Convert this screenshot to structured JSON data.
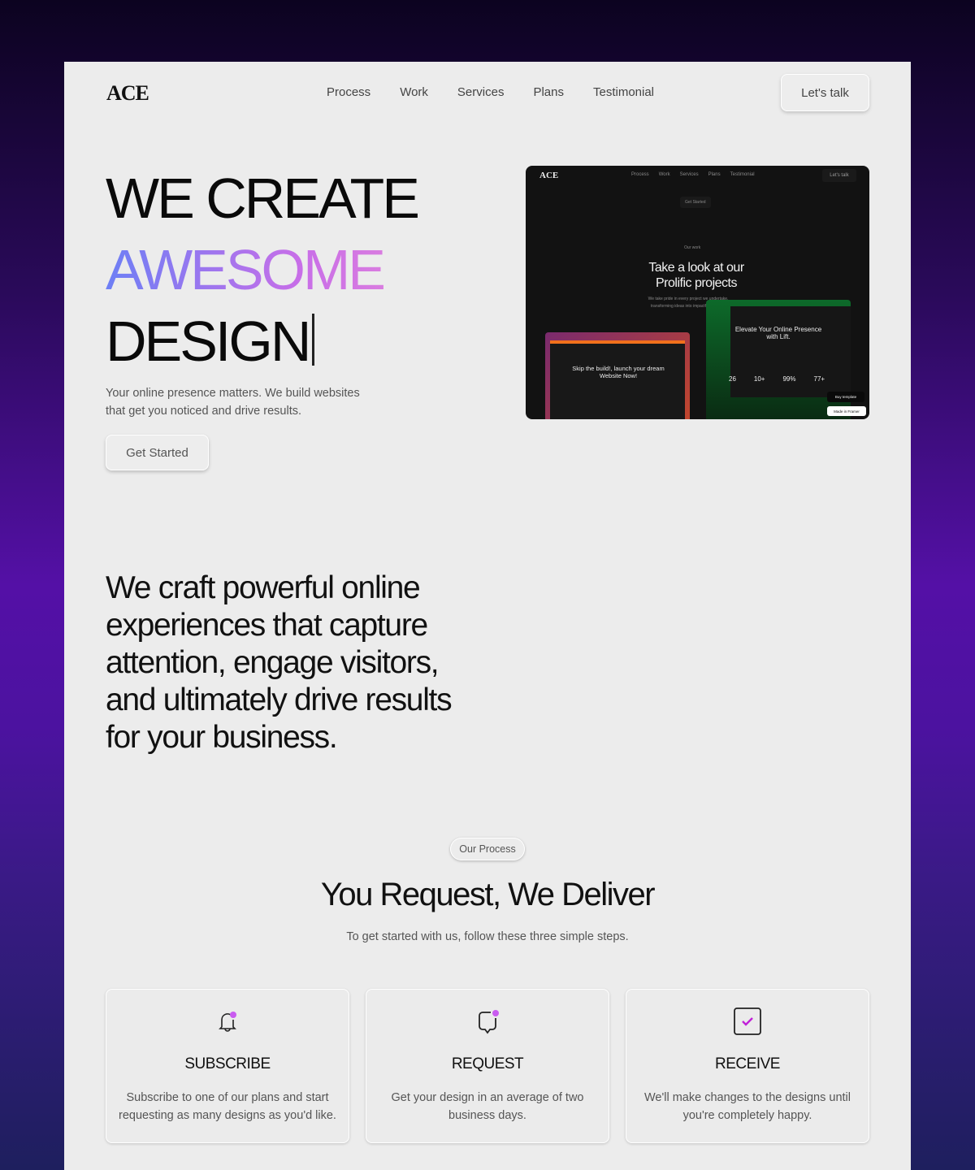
{
  "nav": {
    "logo": "ACE",
    "links": [
      "Process",
      "Work",
      "Services",
      "Plans",
      "Testimonial"
    ],
    "cta": "Let's talk"
  },
  "hero": {
    "line1": "WE CREATE",
    "line2": "AWESOME",
    "line3": "DESIGN",
    "subtitle": "Your online presence matters. We build websites that get you noticed and drive results.",
    "button": "Get Started"
  },
  "preview": {
    "logo": "ACE",
    "links": [
      "Process",
      "Work",
      "Services",
      "Plans",
      "Testimonial"
    ],
    "cta": "Let's talk",
    "get_started": "Get Started",
    "tag": "Our work",
    "heading": "Take a look at our Prolific projects",
    "desc": "We take pride in every project we undertake, transforming ideas into impactful realities.",
    "card1_title": "Skip the build!, launch your dream Website Now!",
    "card2_title": "Elevate Your Online Presence with Lift.",
    "stats": [
      "26",
      "10+",
      "99%",
      "77+"
    ],
    "buy": "Buy template",
    "framer": "Made in Framer"
  },
  "about": {
    "text": "We craft powerful online experiences that capture attention, engage visitors, and ultimately drive results for your business."
  },
  "process": {
    "badge": "Our Process",
    "title": "You Request, We Deliver",
    "subtitle": "To get started with us, follow these three simple steps.",
    "accent": "#c95cf0",
    "steps": [
      {
        "icon": "bell-icon",
        "title": "SUBSCRIBE",
        "desc": "Subscribe to one of our plans and start requesting as many designs as you'd like."
      },
      {
        "icon": "chat-bubble-icon",
        "title": "REQUEST",
        "desc": "Get your design in an average of two business days."
      },
      {
        "icon": "checkbox-icon",
        "title": "RECEIVE",
        "desc": "We'll make changes to the designs until you're completely happy."
      }
    ]
  }
}
